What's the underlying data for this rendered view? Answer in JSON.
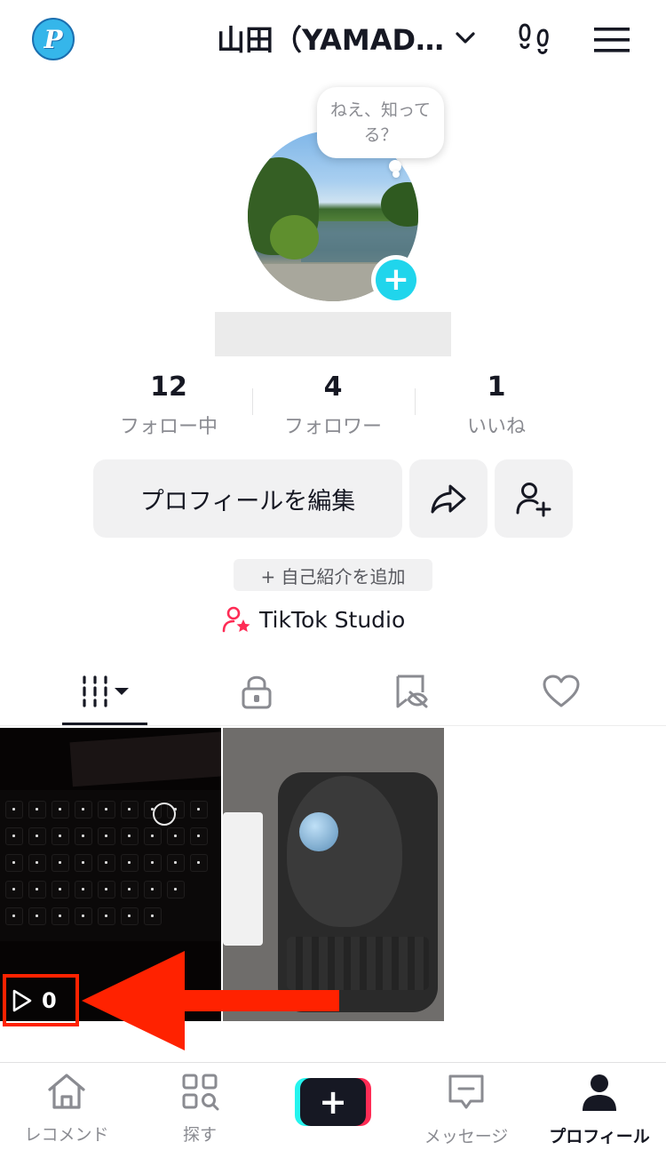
{
  "header": {
    "logo_letter": "P",
    "username": "山田（YAMAD…",
    "footprint_icon": "footprint-icon",
    "menu_icon": "hamburger-menu-icon"
  },
  "profile": {
    "bubble_text": "ねえ、知ってる？",
    "add_avatar_label": "+",
    "stats": [
      {
        "value": "12",
        "label": "フォロー中"
      },
      {
        "value": "4",
        "label": "フォロワー"
      },
      {
        "value": "1",
        "label": "いいね"
      }
    ],
    "edit_button": "プロフィールを編集",
    "bio_button": "+ 自己紹介を追加",
    "studio_label": "TikTok Studio"
  },
  "tabs": [
    {
      "name": "videos",
      "icon": "grid-filter-icon",
      "active": true
    },
    {
      "name": "private",
      "icon": "lock-icon",
      "active": false
    },
    {
      "name": "reposts",
      "icon": "hidden-tag-icon",
      "active": false
    },
    {
      "name": "liked",
      "icon": "heart-icon",
      "active": false
    }
  ],
  "videos": [
    {
      "subject": "keyboard",
      "play_count": "0"
    },
    {
      "subject": "trackball-mouse"
    }
  ],
  "bottom_nav": [
    {
      "label": "レコメンド",
      "icon": "home-icon"
    },
    {
      "label": "探す",
      "icon": "explore-icon"
    },
    {
      "label": "+",
      "icon": "create-plus-icon"
    },
    {
      "label": "メッセージ",
      "icon": "message-icon"
    },
    {
      "label": "プロフィール",
      "icon": "profile-icon",
      "active": true
    }
  ],
  "colors": {
    "accent_cyan": "#20d5ec",
    "studio_pink": "#fe2c55",
    "annotation_red": "#ff2200",
    "text_primary": "#161823",
    "text_secondary": "#8a8b91"
  }
}
